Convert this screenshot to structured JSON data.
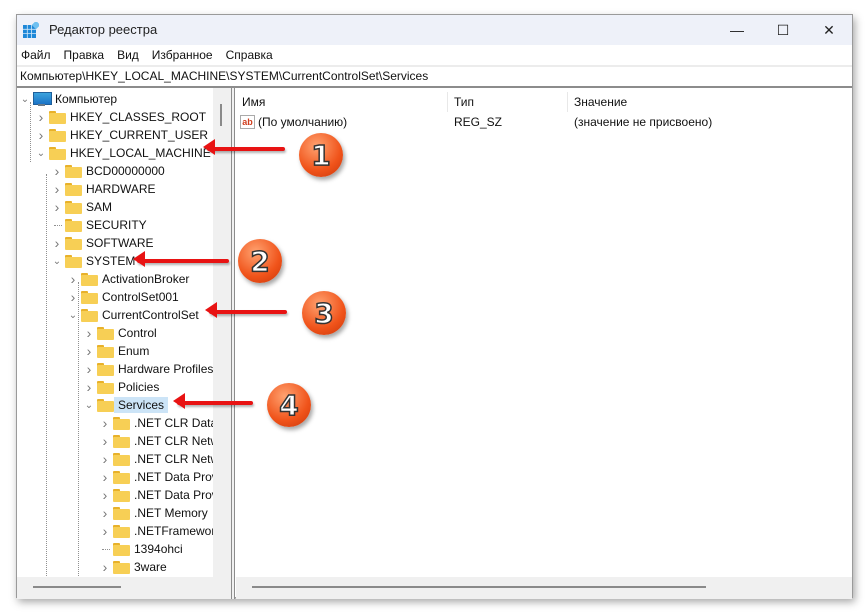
{
  "window": {
    "title": "Редактор реестра",
    "controls": {
      "minimize": "—",
      "maximize": "☐",
      "close": "✕"
    }
  },
  "menu": [
    "Файл",
    "Правка",
    "Вид",
    "Избранное",
    "Справка"
  ],
  "address": "Компьютер\\HKEY_LOCAL_MACHINE\\SYSTEM\\CurrentControlSet\\Services",
  "tree": {
    "root": "Компьютер",
    "nodes": [
      {
        "label": "HKEY_CLASSES_ROOT",
        "state": "collapsed"
      },
      {
        "label": "HKEY_CURRENT_USER",
        "state": "collapsed"
      },
      {
        "label": "HKEY_LOCAL_MACHINE",
        "state": "expanded"
      },
      {
        "label": "BCD00000000",
        "state": "collapsed"
      },
      {
        "label": "HARDWARE",
        "state": "collapsed"
      },
      {
        "label": "SAM",
        "state": "collapsed"
      },
      {
        "label": "SECURITY",
        "state": "leaf"
      },
      {
        "label": "SOFTWARE",
        "state": "collapsed"
      },
      {
        "label": "SYSTEM",
        "state": "expanded"
      },
      {
        "label": "ActivationBroker",
        "state": "collapsed"
      },
      {
        "label": "ControlSet001",
        "state": "collapsed"
      },
      {
        "label": "CurrentControlSet",
        "state": "expanded"
      },
      {
        "label": "Control",
        "state": "collapsed"
      },
      {
        "label": "Enum",
        "state": "collapsed"
      },
      {
        "label": "Hardware Profiles",
        "state": "collapsed"
      },
      {
        "label": "Policies",
        "state": "collapsed"
      },
      {
        "label": "Services",
        "state": "expanded",
        "selected": true
      },
      {
        "label": ".NET CLR Data",
        "state": "collapsed"
      },
      {
        "label": ".NET CLR Netw",
        "state": "collapsed"
      },
      {
        "label": ".NET CLR Netw",
        "state": "collapsed"
      },
      {
        "label": ".NET Data Prov",
        "state": "collapsed"
      },
      {
        "label": ".NET Data Prov",
        "state": "collapsed"
      },
      {
        "label": ".NET Memory",
        "state": "collapsed"
      },
      {
        "label": ".NETFramewor",
        "state": "collapsed"
      },
      {
        "label": "1394ohci",
        "state": "leaf"
      },
      {
        "label": "3ware",
        "state": "collapsed"
      }
    ]
  },
  "list": {
    "columns": [
      "Имя",
      "Тип",
      "Значение"
    ],
    "rows": [
      {
        "icon": "ab",
        "name": "(По умолчанию)",
        "type": "REG_SZ",
        "value": "(значение не присвоено)"
      }
    ]
  },
  "annotations": [
    "1",
    "2",
    "3",
    "4"
  ],
  "colors": {
    "arrow": "#e81313",
    "badge": "#f0531a",
    "selection": "#cce4f7"
  }
}
